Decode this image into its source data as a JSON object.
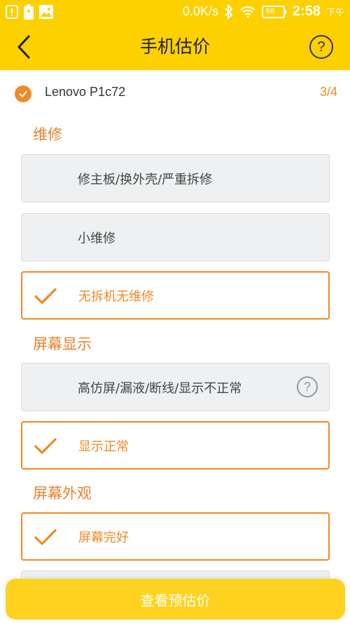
{
  "status_bar": {
    "network_speed": "0.0K/s",
    "battery": "66",
    "time": "2:58",
    "ampm": "下午"
  },
  "header": {
    "title": "手机估价"
  },
  "device": {
    "name": "Lenovo P1c72",
    "step": "3/4"
  },
  "sections": [
    {
      "label": "维修",
      "options": [
        {
          "label": "修主板/换外壳/严重拆修",
          "selected": false
        },
        {
          "label": "小维修",
          "selected": false
        },
        {
          "label": "无拆机无维修",
          "selected": true
        }
      ]
    },
    {
      "label": "屏幕显示",
      "options": [
        {
          "label": "高仿屏/漏液/断线/显示不正常",
          "selected": false,
          "has_help": true
        },
        {
          "label": "显示正常",
          "selected": true
        }
      ]
    },
    {
      "label": "屏幕外观",
      "options": [
        {
          "label": "屏幕完好",
          "selected": true
        }
      ]
    }
  ],
  "footer": {
    "button_label": "查看预估价"
  },
  "colors": {
    "brand_yellow": "#FDD000",
    "accent_orange": "#F08A24",
    "option_bg": "#EEF0F2"
  }
}
